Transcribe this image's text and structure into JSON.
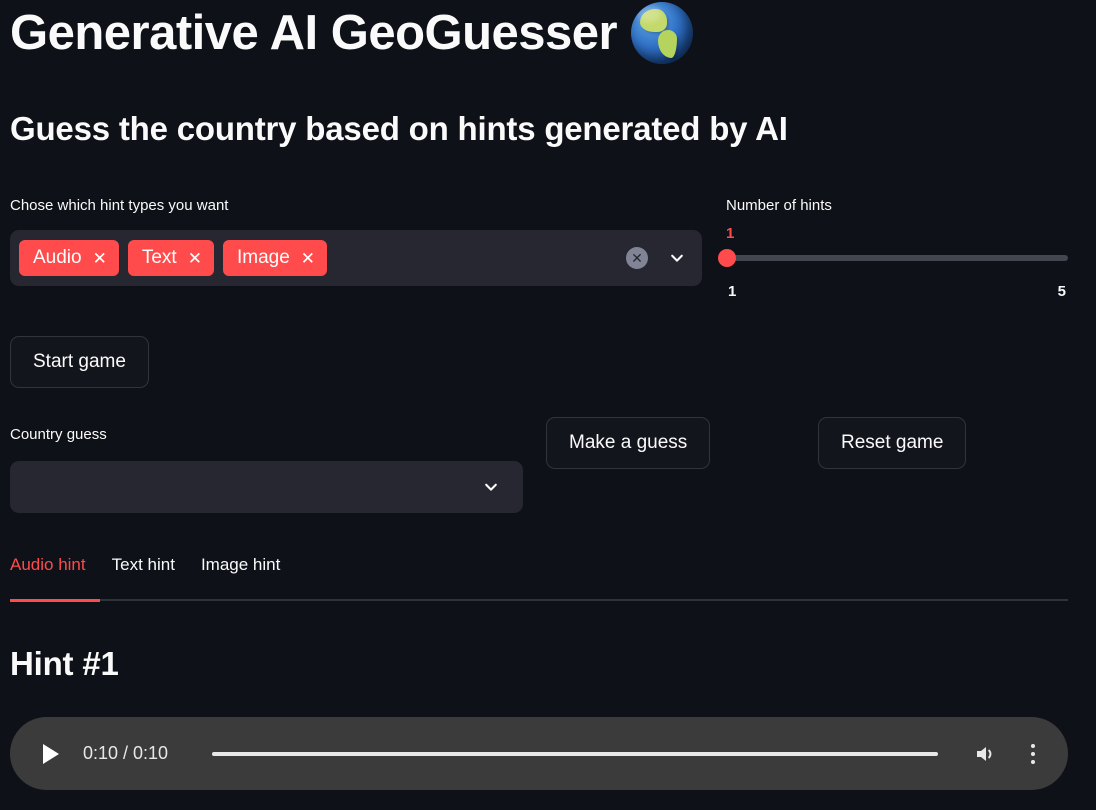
{
  "header": {
    "title": "Generative AI GeoGuesser",
    "title_icon": "globe-americas-icon",
    "subtitle": "Guess the country based on hints generated by AI"
  },
  "hint_types": {
    "label": "Chose which hint types you want",
    "tags": [
      {
        "label": "Audio",
        "remove_icon": "close-icon"
      },
      {
        "label": "Text",
        "remove_icon": "close-icon"
      },
      {
        "label": "Image",
        "remove_icon": "close-icon"
      }
    ],
    "clear_all_icon": "clear-circle-icon",
    "dropdown_icon": "chevron-down-icon",
    "tag_color": "#ff4b4b",
    "field_bg": "#262730"
  },
  "hint_count_slider": {
    "label": "Number of hints",
    "value": "1",
    "min": "1",
    "max": "5",
    "accent_color": "#ff4b4b",
    "track_color": "#43454f"
  },
  "buttons": {
    "start_game": "Start game",
    "make_guess": "Make a guess",
    "reset_game": "Reset game"
  },
  "country_guess": {
    "label": "Country guess",
    "value": "",
    "placeholder": "",
    "dropdown_icon": "chevron-down-icon"
  },
  "tabs": {
    "active_index": 0,
    "items": [
      {
        "label": "Audio hint"
      },
      {
        "label": "Text hint"
      },
      {
        "label": "Image hint"
      }
    ],
    "active_color": "#ff4b4b"
  },
  "hint_panel": {
    "heading": "Hint #1"
  },
  "audio_player": {
    "play_icon": "play-icon",
    "time": "0:10 / 0:10",
    "current_time": "0:10",
    "duration": "0:10",
    "progress_percent": 100,
    "volume_icon": "volume-icon",
    "menu_icon": "more-vertical-icon",
    "background": "#3b3b3b"
  },
  "page": {
    "background": "#0e1117",
    "text_color": "#fafafa"
  }
}
